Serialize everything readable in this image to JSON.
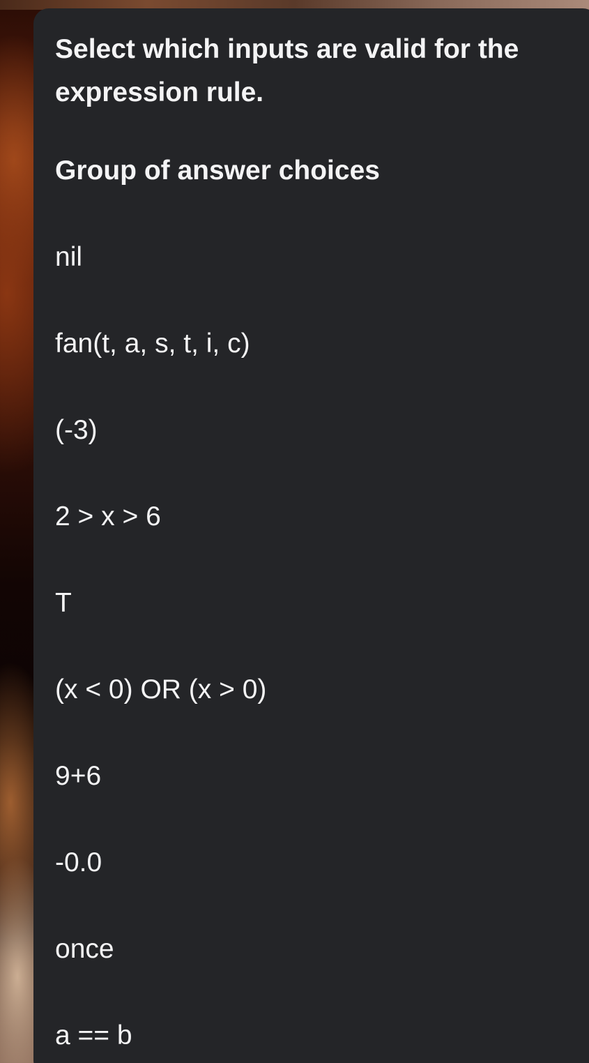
{
  "question": {
    "text": "Select which inputs are valid for the expression rule."
  },
  "group_label": "Group of answer choices",
  "choices": [
    {
      "label": "nil"
    },
    {
      "label": "fan(t, a, s, t, i, c)"
    },
    {
      "label": "(-3)"
    },
    {
      "label": "2 > x > 6"
    },
    {
      "label": "T"
    },
    {
      "label": "(x < 0) OR (x > 0)"
    },
    {
      "label": "9+6"
    },
    {
      "label": "-0.0"
    },
    {
      "label": "once"
    },
    {
      "label": "a == b"
    }
  ]
}
